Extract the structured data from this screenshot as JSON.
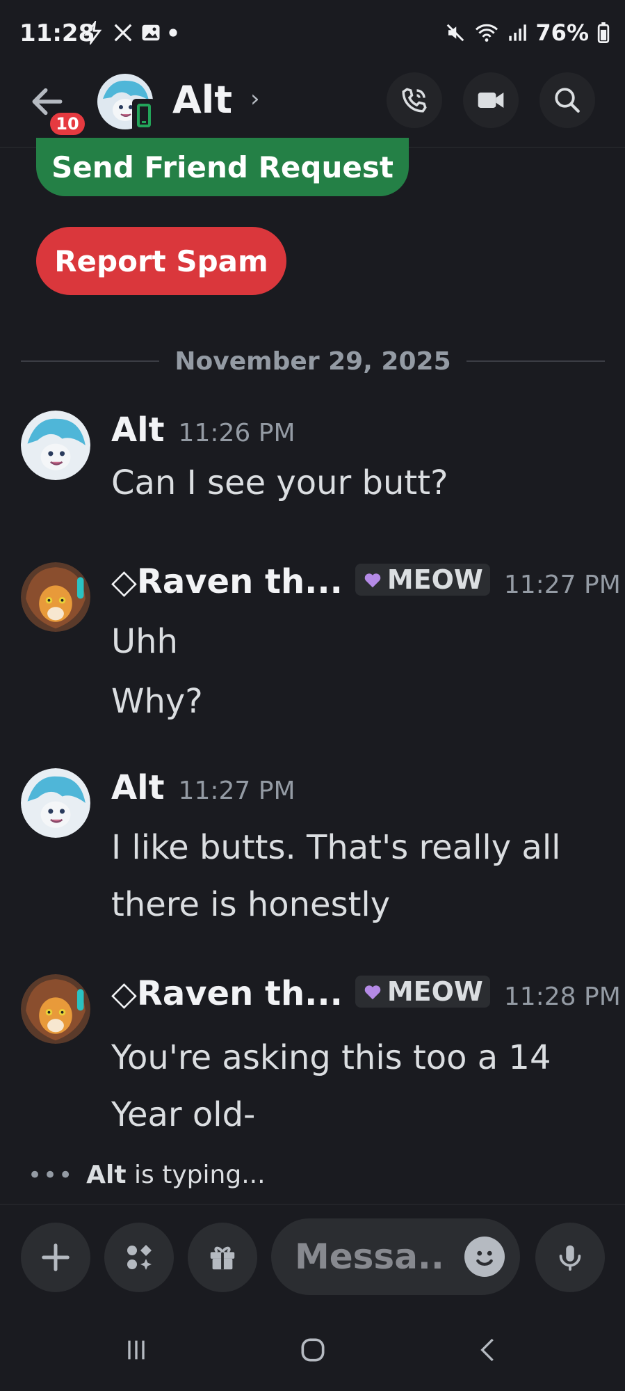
{
  "status_bar": {
    "time": "11:28",
    "battery": "76%",
    "left_icons": [
      "bolt-icon",
      "x-logo-icon",
      "gallery-icon",
      "dot-icon"
    ],
    "right_icons": [
      "mute-icon",
      "wifi-icon",
      "signal-icon",
      "battery-icon"
    ]
  },
  "header": {
    "back_badge": "10",
    "title": "Alt",
    "chevron": "›",
    "actions": [
      "call-icon",
      "video-icon",
      "search-icon"
    ]
  },
  "actions": {
    "send_friend_request": "Send Friend Request",
    "report_spam": "Report Spam"
  },
  "divider": {
    "date": "November 29, 2025"
  },
  "messages": [
    {
      "author": "Alt",
      "time": "11:26 PM",
      "lines": [
        "Can I see your butt?"
      ]
    },
    {
      "author": "◇Raven th...",
      "tag": "MEOW",
      "time": "11:27 PM",
      "lines": [
        "Uhh",
        "Why?"
      ]
    },
    {
      "author": "Alt",
      "time": "11:27 PM",
      "lines": [
        "I like butts. That's really all",
        "there is honestly"
      ]
    },
    {
      "author": "◇Raven th...",
      "tag": "MEOW",
      "time": "11:28 PM",
      "lines": [
        "You're asking this too a 14",
        "Year old-"
      ]
    }
  ],
  "typing": {
    "dots": "•••",
    "name": "Alt",
    "suffix": "is typing..."
  },
  "composer": {
    "placeholder": "Messa..."
  },
  "colors": {
    "background": "#1a1b20",
    "green": "#248046",
    "red": "#da373c",
    "badge": "#e63a40",
    "muted": "#949ba4"
  }
}
